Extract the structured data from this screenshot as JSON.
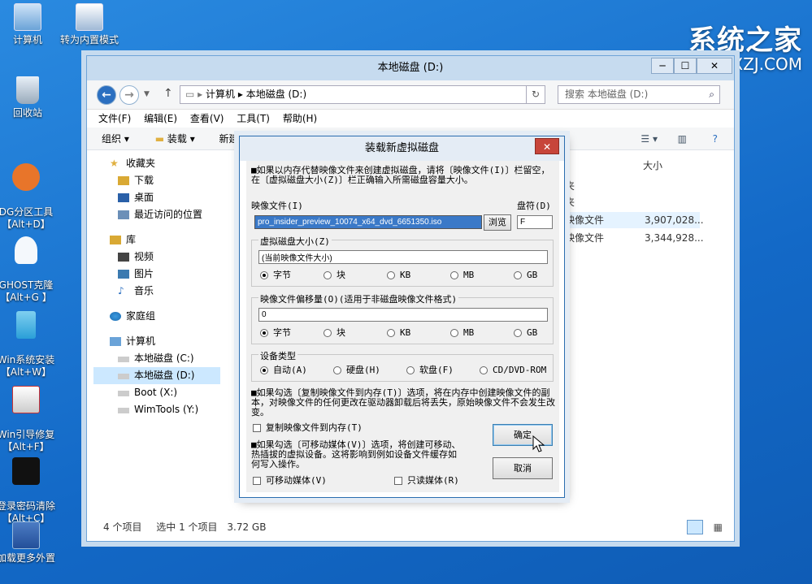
{
  "desktop": {
    "icons": [
      {
        "label": "计算机"
      },
      {
        "label": "转为内置模式"
      },
      {
        "label": "回收站"
      },
      {
        "label": "DG分区工具\n【Alt+D】"
      },
      {
        "label": "GHOST克隆\n【Alt+G 】"
      },
      {
        "label": "Win系统安装\n【Alt+W】"
      },
      {
        "label": "Win引导修复\n【Alt+F】"
      },
      {
        "label": "登录密码清除\n【Alt+C】"
      },
      {
        "label": "加载更多外置"
      }
    ],
    "watermark": {
      "big": "系统之家",
      "small": "XZJ.COM"
    }
  },
  "explorer": {
    "title": "本地磁盘 (D:)",
    "controls": [
      "─",
      "☐",
      "✕"
    ],
    "path": [
      "计算机",
      "本地磁盘 (D:)"
    ],
    "search_placeholder": "搜索 本地磁盘 (D:)",
    "menu": [
      "文件(F)",
      "编辑(E)",
      "查看(V)",
      "工具(T)",
      "帮助(H)"
    ],
    "toolbar": {
      "organize": "组织",
      "mount": "装载",
      "newfolder": "新建文件夹"
    },
    "sidebar": [
      {
        "label": "收藏夹",
        "header": true
      },
      {
        "label": "下载"
      },
      {
        "label": "桌面"
      },
      {
        "label": "最近访问的位置"
      },
      {
        "label": "库",
        "header": true
      },
      {
        "label": "视频"
      },
      {
        "label": "图片"
      },
      {
        "label": "音乐"
      },
      {
        "label": "家庭组",
        "header": true
      },
      {
        "label": "计算机",
        "header": true
      },
      {
        "label": "本地磁盘 (C:)"
      },
      {
        "label": "本地磁盘 (D:)",
        "selected": true
      },
      {
        "label": "Boot (X:)"
      },
      {
        "label": "WimTools (Y:)"
      }
    ],
    "size_header": "大小",
    "rows": [
      {
        "type": "夹",
        "size": ""
      },
      {
        "type": "夹",
        "size": ""
      },
      {
        "type": "映像文件",
        "size": "3,907,028..."
      },
      {
        "type": "映像文件",
        "size": "3,344,928..."
      }
    ],
    "status": {
      "count": "4 个项目",
      "selected": "选中 1 个项目",
      "size": "3.72 GB"
    }
  },
  "dialog": {
    "title": "装载新虚拟磁盘",
    "close": "✕",
    "info1": "■如果以内存代替映像文件来创建虚拟磁盘，请将〔映像文件(I)〕栏留空，在〔虚拟磁盘大小(Z)〕栏正确输入所需磁盘容量大小。",
    "image_label": "映像文件(I)",
    "image_value": "pro_insider_preview_10074_x64_dvd_6651350.iso",
    "browse": "浏览",
    "drive_label": "盘符(D)",
    "drive_value": "F",
    "size_group": "虚拟磁盘大小(Z)",
    "size_value": "(当前映像文件大小)",
    "units": [
      "字节",
      "块",
      "KB",
      "MB",
      "GB"
    ],
    "offset_group": "映像文件偏移量(O)(适用于非磁盘映像文件格式)",
    "offset_value": "0",
    "device_group": "设备类型",
    "devices": [
      "自动(A)",
      "硬盘(H)",
      "软盘(F)",
      "CD/DVD-ROM"
    ],
    "info2": "■如果勾选〔复制映像文件到内存(T)〕选项，将在内存中创建映像文件的副本，对映像文件的任何更改在驱动器卸载后将丢失，原始映像文件不会发生改变。",
    "copy_to_mem": "复制映像文件到内存(T)",
    "info3": "■如果勾选〔可移动媒体(V)〕选项，将创建可移动、热插拔的虚拟设备。这将影响到例如设备文件缓存如何写入操作。",
    "removable": "可移动媒体(V)",
    "readonly": "只读媒体(R)",
    "ok": "确定",
    "cancel": "取消"
  }
}
